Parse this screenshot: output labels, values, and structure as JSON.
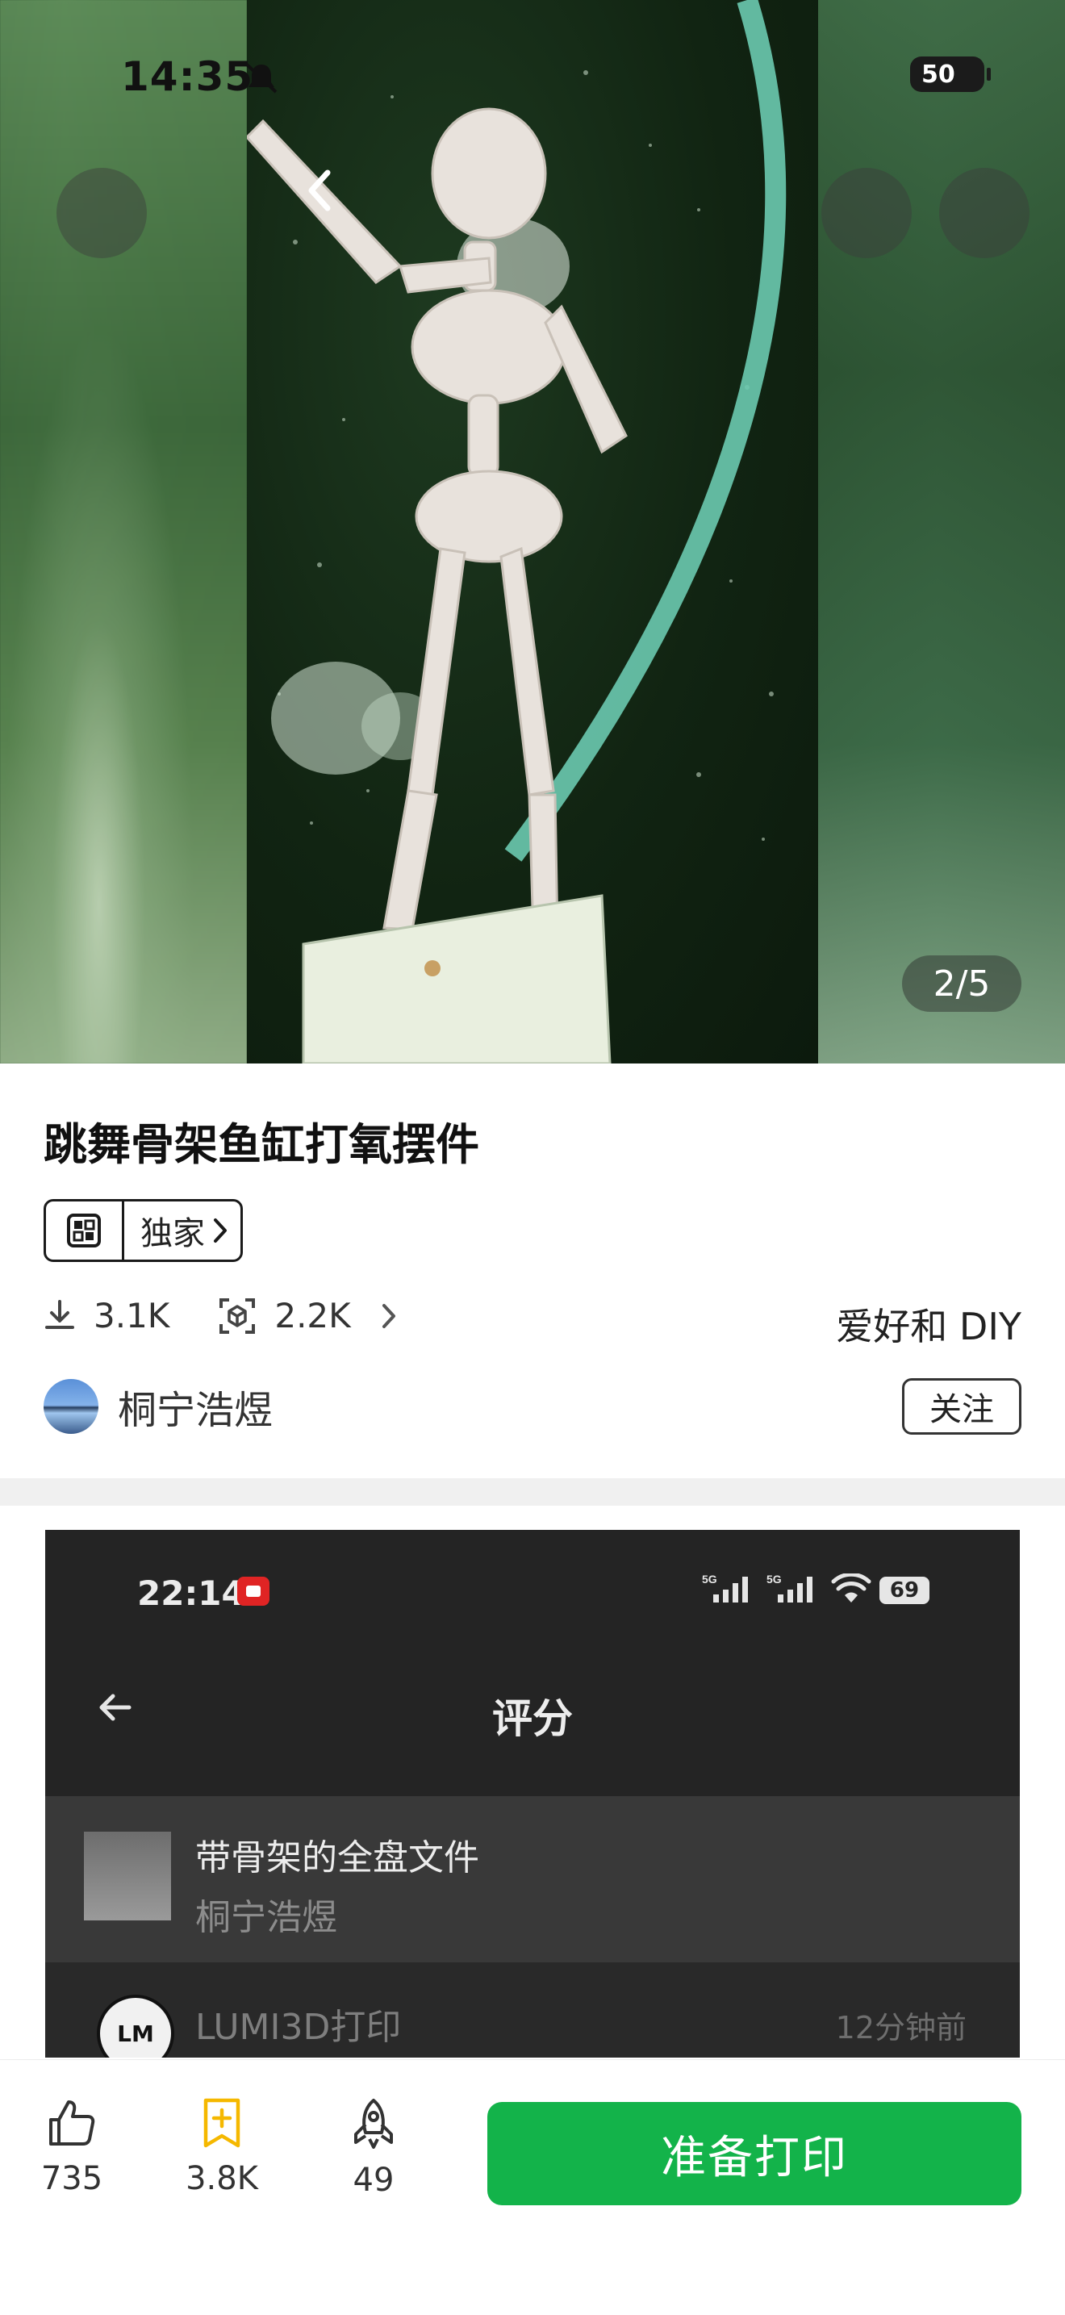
{
  "status_bar": {
    "time": "14:35",
    "battery": "50"
  },
  "hero": {
    "page_indicator": "2/5",
    "icons": [
      "back-arrow-icon",
      "share-icon",
      "more-vertical-icon"
    ]
  },
  "model": {
    "title": "跳舞骨架鱼缸打氧摆件",
    "tag_label": "独家",
    "downloads": "3.1K",
    "prints": "2.2K",
    "category": "爱好和 DIY",
    "author": "桐宁浩煜",
    "follow_label": "关注"
  },
  "embedded_screenshot": {
    "time": "22:14",
    "network_labels": [
      "5G",
      "5G"
    ],
    "battery": "69",
    "title": "评分",
    "file_name": "带骨架的全盘文件",
    "file_author": "桐宁浩煜",
    "commenter": "LUMI3D打印",
    "comment_time": "12分钟前",
    "commenter_logo_text": "LM"
  },
  "bottom_bar": {
    "likes": "735",
    "collects": "3.8K",
    "boosts": "49",
    "print_label": "准备打印",
    "accent_color": "#13b34a",
    "collect_color": "#f5b800"
  }
}
